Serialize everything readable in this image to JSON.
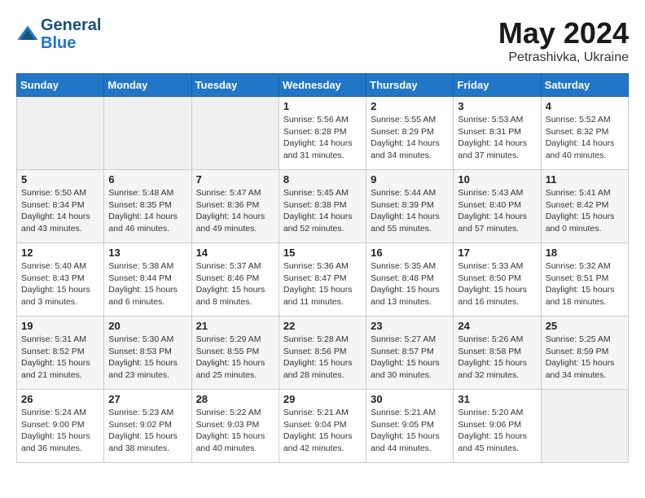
{
  "header": {
    "logo_line1": "General",
    "logo_line2": "Blue",
    "month": "May 2024",
    "location": "Petrashivka, Ukraine"
  },
  "weekdays": [
    "Sunday",
    "Monday",
    "Tuesday",
    "Wednesday",
    "Thursday",
    "Friday",
    "Saturday"
  ],
  "weeks": [
    [
      {
        "day": "",
        "content": ""
      },
      {
        "day": "",
        "content": ""
      },
      {
        "day": "",
        "content": ""
      },
      {
        "day": "1",
        "content": "Sunrise: 5:56 AM\nSunset: 8:28 PM\nDaylight: 14 hours\nand 31 minutes."
      },
      {
        "day": "2",
        "content": "Sunrise: 5:55 AM\nSunset: 8:29 PM\nDaylight: 14 hours\nand 34 minutes."
      },
      {
        "day": "3",
        "content": "Sunrise: 5:53 AM\nSunset: 8:31 PM\nDaylight: 14 hours\nand 37 minutes."
      },
      {
        "day": "4",
        "content": "Sunrise: 5:52 AM\nSunset: 8:32 PM\nDaylight: 14 hours\nand 40 minutes."
      }
    ],
    [
      {
        "day": "5",
        "content": "Sunrise: 5:50 AM\nSunset: 8:34 PM\nDaylight: 14 hours\nand 43 minutes."
      },
      {
        "day": "6",
        "content": "Sunrise: 5:48 AM\nSunset: 8:35 PM\nDaylight: 14 hours\nand 46 minutes."
      },
      {
        "day": "7",
        "content": "Sunrise: 5:47 AM\nSunset: 8:36 PM\nDaylight: 14 hours\nand 49 minutes."
      },
      {
        "day": "8",
        "content": "Sunrise: 5:45 AM\nSunset: 8:38 PM\nDaylight: 14 hours\nand 52 minutes."
      },
      {
        "day": "9",
        "content": "Sunrise: 5:44 AM\nSunset: 8:39 PM\nDaylight: 14 hours\nand 55 minutes."
      },
      {
        "day": "10",
        "content": "Sunrise: 5:43 AM\nSunset: 8:40 PM\nDaylight: 14 hours\nand 57 minutes."
      },
      {
        "day": "11",
        "content": "Sunrise: 5:41 AM\nSunset: 8:42 PM\nDaylight: 15 hours\nand 0 minutes."
      }
    ],
    [
      {
        "day": "12",
        "content": "Sunrise: 5:40 AM\nSunset: 8:43 PM\nDaylight: 15 hours\nand 3 minutes."
      },
      {
        "day": "13",
        "content": "Sunrise: 5:38 AM\nSunset: 8:44 PM\nDaylight: 15 hours\nand 6 minutes."
      },
      {
        "day": "14",
        "content": "Sunrise: 5:37 AM\nSunset: 8:46 PM\nDaylight: 15 hours\nand 8 minutes."
      },
      {
        "day": "15",
        "content": "Sunrise: 5:36 AM\nSunset: 8:47 PM\nDaylight: 15 hours\nand 11 minutes."
      },
      {
        "day": "16",
        "content": "Sunrise: 5:35 AM\nSunset: 8:48 PM\nDaylight: 15 hours\nand 13 minutes."
      },
      {
        "day": "17",
        "content": "Sunrise: 5:33 AM\nSunset: 8:50 PM\nDaylight: 15 hours\nand 16 minutes."
      },
      {
        "day": "18",
        "content": "Sunrise: 5:32 AM\nSunset: 8:51 PM\nDaylight: 15 hours\nand 18 minutes."
      }
    ],
    [
      {
        "day": "19",
        "content": "Sunrise: 5:31 AM\nSunset: 8:52 PM\nDaylight: 15 hours\nand 21 minutes."
      },
      {
        "day": "20",
        "content": "Sunrise: 5:30 AM\nSunset: 8:53 PM\nDaylight: 15 hours\nand 23 minutes."
      },
      {
        "day": "21",
        "content": "Sunrise: 5:29 AM\nSunset: 8:55 PM\nDaylight: 15 hours\nand 25 minutes."
      },
      {
        "day": "22",
        "content": "Sunrise: 5:28 AM\nSunset: 8:56 PM\nDaylight: 15 hours\nand 28 minutes."
      },
      {
        "day": "23",
        "content": "Sunrise: 5:27 AM\nSunset: 8:57 PM\nDaylight: 15 hours\nand 30 minutes."
      },
      {
        "day": "24",
        "content": "Sunrise: 5:26 AM\nSunset: 8:58 PM\nDaylight: 15 hours\nand 32 minutes."
      },
      {
        "day": "25",
        "content": "Sunrise: 5:25 AM\nSunset: 8:59 PM\nDaylight: 15 hours\nand 34 minutes."
      }
    ],
    [
      {
        "day": "26",
        "content": "Sunrise: 5:24 AM\nSunset: 9:00 PM\nDaylight: 15 hours\nand 36 minutes."
      },
      {
        "day": "27",
        "content": "Sunrise: 5:23 AM\nSunset: 9:02 PM\nDaylight: 15 hours\nand 38 minutes."
      },
      {
        "day": "28",
        "content": "Sunrise: 5:22 AM\nSunset: 9:03 PM\nDaylight: 15 hours\nand 40 minutes."
      },
      {
        "day": "29",
        "content": "Sunrise: 5:21 AM\nSunset: 9:04 PM\nDaylight: 15 hours\nand 42 minutes."
      },
      {
        "day": "30",
        "content": "Sunrise: 5:21 AM\nSunset: 9:05 PM\nDaylight: 15 hours\nand 44 minutes."
      },
      {
        "day": "31",
        "content": "Sunrise: 5:20 AM\nSunset: 9:06 PM\nDaylight: 15 hours\nand 45 minutes."
      },
      {
        "day": "",
        "content": ""
      }
    ]
  ]
}
